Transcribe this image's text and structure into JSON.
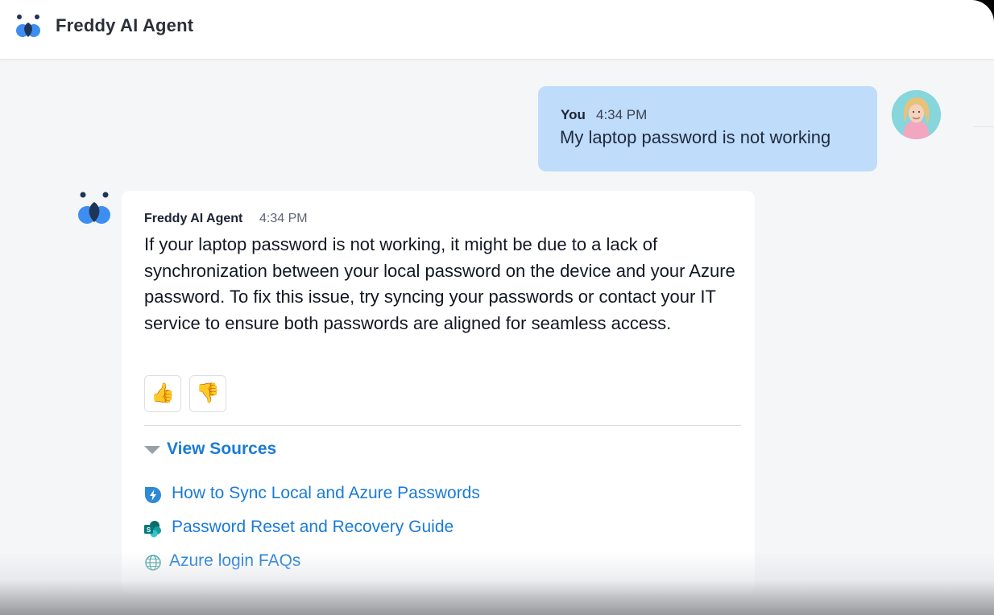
{
  "header": {
    "title": "Freddy AI Agent",
    "logo_icon": "freddy-logo-icon"
  },
  "colors": {
    "user_bubble": "#bfdcfb",
    "link": "#1a7bd6",
    "logo_blue": "#3d8ef0",
    "logo_dark": "#1f3557"
  },
  "user_message": {
    "sender": "You",
    "time": "4:34 PM",
    "text": "My laptop password is not working"
  },
  "bot_message": {
    "sender": "Freddy AI Agent",
    "time": "4:34 PM",
    "text": "If your laptop password is not working, it might be due to a lack of synchronization between your local password on the device and your Azure password. To fix this issue, try syncing your passwords or contact your IT service to ensure both passwords are aligned for seamless access.",
    "reactions": [
      {
        "icon": "thumbs-up-icon",
        "glyph": "👍"
      },
      {
        "icon": "thumbs-down-icon",
        "glyph": "👎"
      }
    ],
    "sources_label": "View Sources",
    "sources": [
      {
        "label": "How to Sync Local and Azure Passwords",
        "icon": "freshservice-icon"
      },
      {
        "label": "Password Reset and Recovery Guide",
        "icon": "sharepoint-icon"
      },
      {
        "label": "Azure login FAQs",
        "icon": "globe-icon"
      }
    ]
  }
}
